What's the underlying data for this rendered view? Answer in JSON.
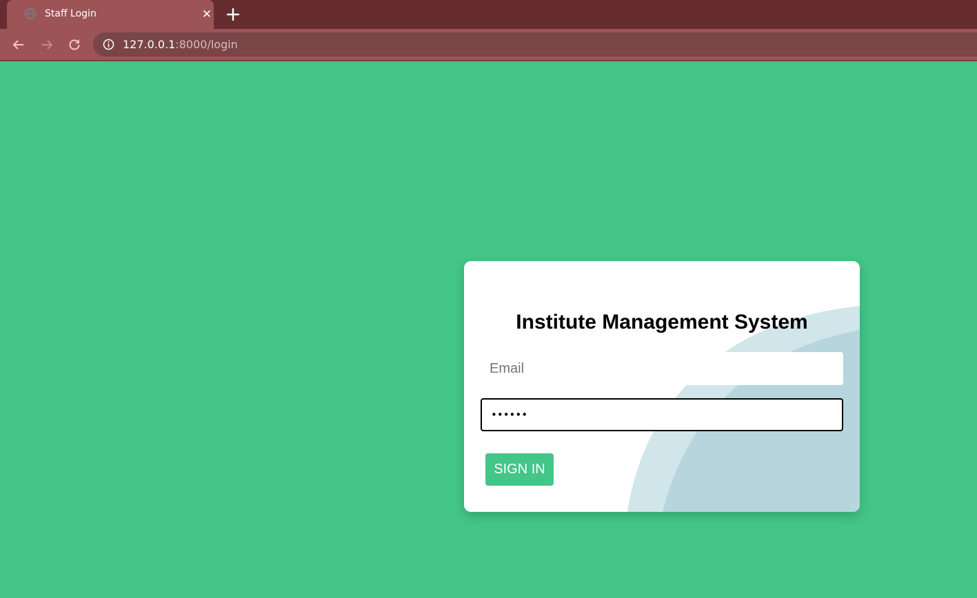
{
  "browser": {
    "tab_title": "Staff Login",
    "url_host": "127.0.0.1",
    "url_path": ":8000/login",
    "icons": {
      "favicon": "globe-icon",
      "close": "close-icon",
      "new_tab": "plus-icon",
      "back": "back-arrow-icon",
      "forward": "forward-arrow-icon",
      "reload": "reload-icon",
      "site_info": "info-icon"
    }
  },
  "login": {
    "title": "Institute Management System",
    "email_placeholder": "Email",
    "email_value": "",
    "password_value": "••••••",
    "signin_label": "SIGN IN"
  },
  "colors": {
    "page_background": "#43c688",
    "chrome_dark": "#672c2f",
    "chrome_tab": "#9c5457",
    "card_background": "#ffffff",
    "card_wave_light": "#d1e6ea",
    "card_wave_dark": "#b6d5dc",
    "button_background": "#43c688"
  }
}
